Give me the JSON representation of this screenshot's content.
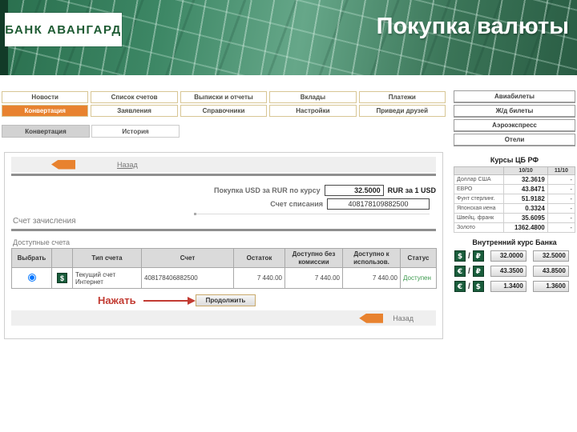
{
  "header": {
    "logo": "БАНК АВАНГАРД",
    "title": "Покупка валюты"
  },
  "nav": {
    "row1": [
      "Новости",
      "Список счетов",
      "Выписки и отчеты",
      "Вклады",
      "Платежи"
    ],
    "row2": [
      "Конвертация",
      "Заявления",
      "Справочники",
      "Настройки",
      "Приведи друзей"
    ],
    "active": "Конвертация"
  },
  "subtabs": [
    {
      "label": "Конвертация",
      "active": true
    },
    {
      "label": "История",
      "active": false
    }
  ],
  "services": [
    "Авиабилеты",
    "Ж/д билеты",
    "Аэроэкспресс",
    "Отели"
  ],
  "main": {
    "back_label": "Назад",
    "purchase": {
      "rate_label": "Покупка USD за RUR  по курсу",
      "rate_value": "32.5000",
      "rate_suffix": "RUR за 1 USD",
      "debit_label": "Счет списания",
      "debit_account": "408178109882500"
    },
    "credit_section_title": "Счет зачисления",
    "accounts_label": "Доступные счета",
    "table": {
      "headers": [
        "Выбрать",
        "",
        "Тип счета",
        "Счет",
        "Остаток",
        "Доступно без комиссии",
        "Доступно к использов.",
        "Статус"
      ],
      "row": {
        "currency_icon": "dollar-icon",
        "type": "Текущий счет Интернет",
        "account": "408178406882500",
        "balance": "7 440.00",
        "available_no_fee": "7 440.00",
        "available_use": "7 440.00",
        "status": "Доступен"
      }
    },
    "press_label": "Нажать",
    "continue_label": "Продолжить",
    "back_bottom_label": "Назад"
  },
  "rates_cb": {
    "title": "Курсы ЦБ РФ",
    "date_cols": [
      "10/10",
      "11/10"
    ],
    "rows": [
      {
        "name": "Доллар США",
        "v1": "32.3619",
        "v2": "-"
      },
      {
        "name": "ЕВРО",
        "v1": "43.8471",
        "v2": "-"
      },
      {
        "name": "Фунт стерлинг.",
        "v1": "51.9182",
        "v2": "-"
      },
      {
        "name": "Японская иена",
        "v1": "0.3324",
        "v2": "-"
      },
      {
        "name": "Швейц. франк",
        "v1": "35.6095",
        "v2": "-"
      },
      {
        "name": "Золото",
        "v1": "1362.4800",
        "v2": "-"
      }
    ]
  },
  "rates_internal": {
    "title": "Внутренний курс Банка",
    "separator": "/",
    "rows": [
      {
        "c1": "$",
        "c2": "₽",
        "buy": "32.0000",
        "sell": "32.5000"
      },
      {
        "c1": "€",
        "c2": "₽",
        "buy": "43.3500",
        "sell": "43.8500"
      },
      {
        "c1": "€",
        "c2": "$",
        "buy": "1.3400",
        "sell": "1.3600"
      }
    ]
  },
  "colors": {
    "accent_orange": "#E8822F",
    "brand_green": "#1E5B33",
    "icon_green": "#1A5D3C",
    "status_green": "#3C9A4E",
    "action_red": "#C23B32",
    "tab_border_tan": "#D8C694"
  }
}
